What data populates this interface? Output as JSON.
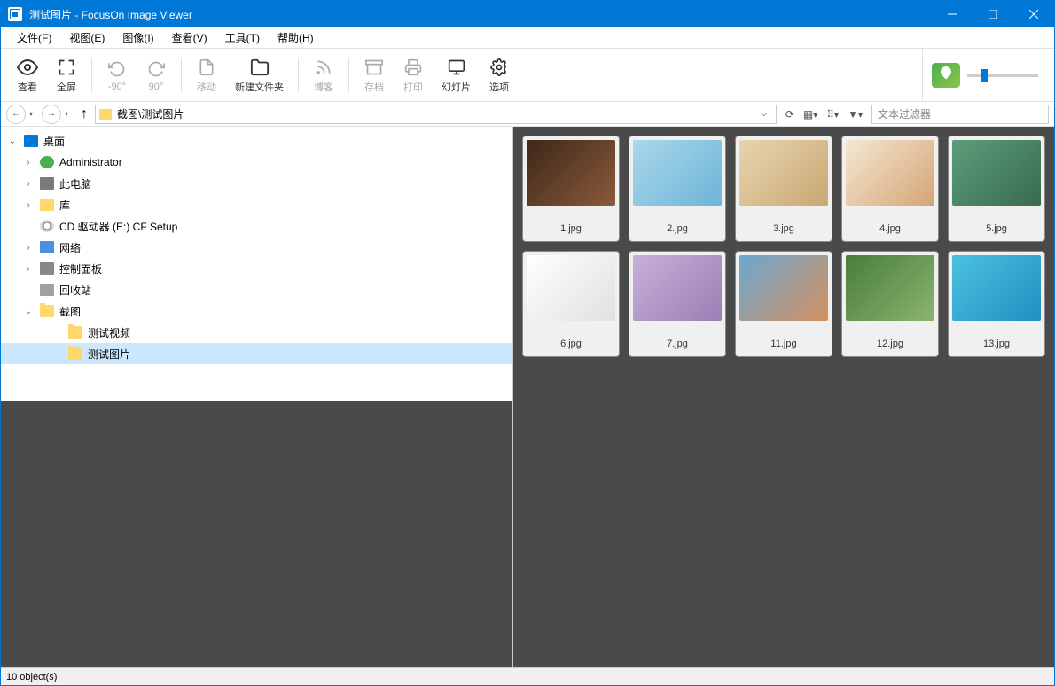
{
  "title": "测试图片 - FocusOn Image Viewer",
  "menu": {
    "file": "文件(F)",
    "view": "视图(E)",
    "image": "图像(I)",
    "look": "查看(V)",
    "tools": "工具(T)",
    "help": "帮助(H)"
  },
  "toolbar": {
    "view": "查看",
    "fullscreen": "全屏",
    "rotleft": "-90°",
    "rotright": "90°",
    "move": "移动",
    "newfolder": "新建文件夹",
    "blog": "博客",
    "archive": "存档",
    "print": "打印",
    "slideshow": "幻灯片",
    "options": "选项"
  },
  "path": "截图\\测试图片",
  "filter_placeholder": "文本过滤器",
  "tree": {
    "desktop": "桌面",
    "admin": "Administrator",
    "thispc": "此电脑",
    "lib": "库",
    "cd": "CD 驱动器 (E:) CF Setup",
    "net": "网络",
    "cp": "控制面板",
    "bin": "回收站",
    "screenshot": "截图",
    "testvideo": "测试视频",
    "testimage": "测试图片"
  },
  "thumbs": [
    {
      "name": "1.jpg",
      "cls": "gr-1"
    },
    {
      "name": "2.jpg",
      "cls": "gr-2"
    },
    {
      "name": "3.jpg",
      "cls": "gr-3"
    },
    {
      "name": "4.jpg",
      "cls": "gr-4"
    },
    {
      "name": "5.jpg",
      "cls": "gr-5"
    },
    {
      "name": "6.jpg",
      "cls": "gr-6"
    },
    {
      "name": "7.jpg",
      "cls": "gr-7"
    },
    {
      "name": "11.jpg",
      "cls": "gr-8"
    },
    {
      "name": "12.jpg",
      "cls": "gr-9"
    },
    {
      "name": "13.jpg",
      "cls": "gr-10"
    }
  ],
  "status": "10 object(s)"
}
